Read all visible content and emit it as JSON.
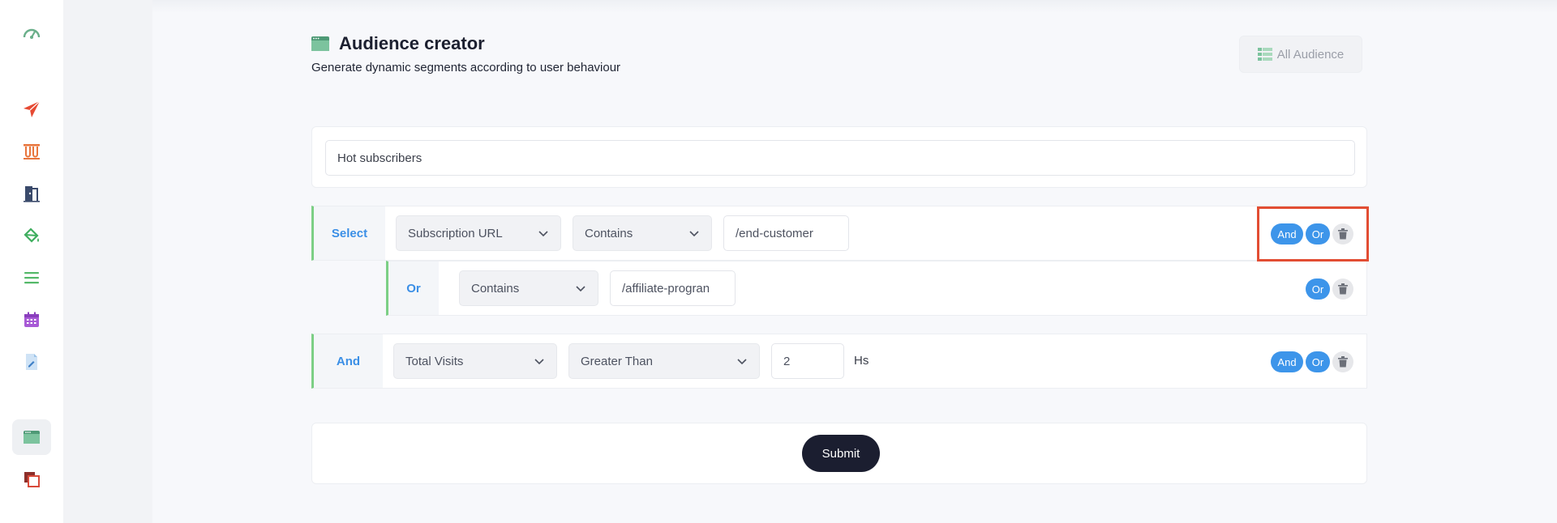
{
  "header": {
    "title": "Audience creator",
    "subtitle": "Generate dynamic segments according to user behaviour",
    "all_audience_label": "All Audience"
  },
  "audience_name": {
    "value": "Hot subscribers",
    "placeholder": ""
  },
  "rules": [
    {
      "label": "Select",
      "field": "Subscription URL",
      "operator": "Contains",
      "value": "/end-customer",
      "buttons": {
        "and": "And",
        "or": "Or"
      }
    },
    {
      "label": "Or",
      "operator": "Contains",
      "value": "/affiliate-progran",
      "buttons": {
        "or": "Or"
      }
    },
    {
      "label": "And",
      "field": "Total Visits",
      "operator": "Greater Than",
      "value": "2",
      "unit": "Hs",
      "buttons": {
        "and": "And",
        "or": "Or"
      }
    }
  ],
  "submit_label": "Submit",
  "sidebar": {
    "icons": [
      "dashboard-icon",
      "send-icon",
      "flask-icon",
      "exit-door-icon",
      "paint-bucket-icon",
      "list-icon",
      "calendar-icon",
      "edit-document-icon",
      "audience-window-icon",
      "copy-icon"
    ]
  },
  "colors": {
    "accent_blue": "#3d95ea",
    "rule_border_green": "#7ccf85",
    "submit_dark": "#1b1e30",
    "highlight_red": "#e24d33"
  }
}
